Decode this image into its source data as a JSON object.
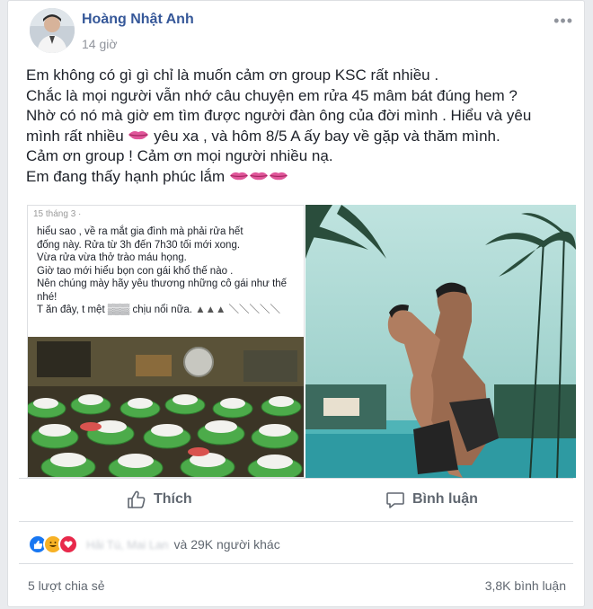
{
  "post": {
    "author": "Hoàng Nhật Anh",
    "time": "14 giờ",
    "more": "•••",
    "line1": "Em không có gì gì chỉ là muốn cảm ơn group KSC rất nhiều .",
    "line2": "Chắc là mọi người vẫn nhớ câu chuyện em rửa 45 mâm bát đúng hem ?",
    "line3": "Nhờ có nó mà giờ em tìm được người đàn ông của đời mình . Hiểu và yêu",
    "line4a": "mình rất nhiều",
    "line4b": " yêu xa , và hôm 8/5 A ấy bay về gặp và thăm mình.",
    "line5": "Cảm ơn group ! Cảm ơn mọi người nhiều nạ.",
    "line6": "Em đang thấy hạnh phúc lắm"
  },
  "embedded": {
    "date": "15 tháng 3 ·",
    "lines": [
      "hiểu sao , về ra mắt gia đình mà phải rửa hết",
      "đống này. Rửa từ 3h đến 7h30 tối mới xong.",
      "Vừa rửa vừa thở trào máu họng.",
      "Giờ tao mới hiểu bọn con gái khổ thế nào .",
      "Nên chúng mày hãy yêu thương những cô gái như thế",
      "nhé!",
      "T ăn đây, t mệt ▒▒▒ chịu nổi nữa."
    ]
  },
  "actions": {
    "like": "Thích",
    "comment": "Bình luận"
  },
  "reactions": {
    "blurred_names": "Hải Tú, Mai Lan",
    "others": "và 29K người khác"
  },
  "footer": {
    "shares": "5 lượt chia sẻ",
    "comments": "3,8K bình luận"
  },
  "colors": {
    "link": "#365899",
    "secondary": "#90949c",
    "like_blue": "#1877f2",
    "haha_yellow": "#f7b125",
    "love_red": "#e8294b",
    "lips": "#e0569a"
  }
}
